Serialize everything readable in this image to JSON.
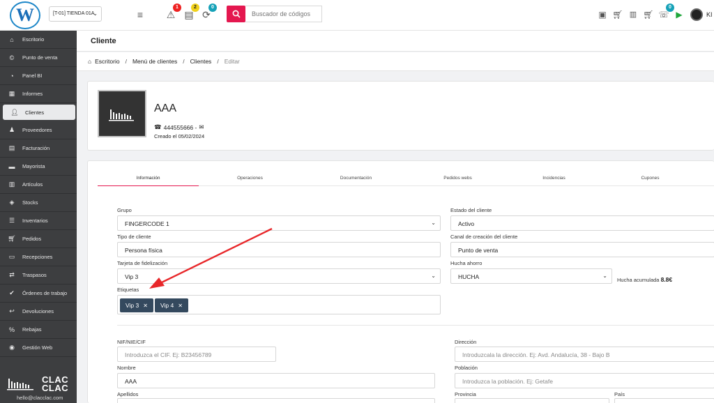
{
  "topbar": {
    "logo_letter": "W",
    "store_selector": "[T-01] TIENDA 01A",
    "badges": {
      "alerts": "1",
      "docs": "2",
      "refresh": "0",
      "messages": "0"
    },
    "search_placeholder": "Buscador de códigos",
    "user_initials": "KI"
  },
  "sidebar": {
    "items": [
      {
        "label": "Escritorio",
        "icon": "home-icon"
      },
      {
        "label": "Punto de venta",
        "icon": "cash-icon"
      },
      {
        "label": "Panel BI",
        "icon": "pie-chart-icon"
      },
      {
        "label": "Informes",
        "icon": "bar-chart-icon"
      },
      {
        "label": "Clientes",
        "icon": "users-icon"
      },
      {
        "label": "Proveedores",
        "icon": "supplier-icon"
      },
      {
        "label": "Facturación",
        "icon": "invoice-icon"
      },
      {
        "label": "Mayorista",
        "icon": "warehouse-icon"
      },
      {
        "label": "Artículos",
        "icon": "barcode-icon"
      },
      {
        "label": "Stocks",
        "icon": "tags-icon"
      },
      {
        "label": "Inventarios",
        "icon": "list-icon"
      },
      {
        "label": "Pedidos",
        "icon": "cart-icon"
      },
      {
        "label": "Recepciones",
        "icon": "inbox-icon"
      },
      {
        "label": "Traspasos",
        "icon": "transfer-icon"
      },
      {
        "label": "Órdenes de trabajo",
        "icon": "check-icon"
      },
      {
        "label": "Devoluciones",
        "icon": "return-cart-icon"
      },
      {
        "label": "Rebajas",
        "icon": "sale-icon"
      },
      {
        "label": "Gestión Web",
        "icon": "globe-icon"
      }
    ],
    "active_index": 4,
    "brand_line1": "CLAC",
    "brand_line2": "CLAC",
    "brand_email": "hello@clacclac.com"
  },
  "page": {
    "title": "Cliente",
    "breadcrumb": [
      "Escritorio",
      "Menú de clientes",
      "Clientes",
      "Editar"
    ]
  },
  "profile": {
    "name": "AAA",
    "phone": "444555666 -",
    "created": "Creado el 05/02/2024"
  },
  "tabs": [
    "Información",
    "Operaciones",
    "Documentación",
    "Pedidos webs",
    "Incidencias",
    "Cupones"
  ],
  "form": {
    "grupo_label": "Grupo",
    "grupo_value": "FINGERCODE 1",
    "estado_label": "Estado del cliente",
    "estado_value": "Activo",
    "tipo_label": "Tipo de cliente",
    "tipo_value": "Persona física",
    "canal_label": "Canal de creación del cliente",
    "canal_value": "Punto de venta",
    "tarjeta_label": "Tarjeta de fidelización",
    "tarjeta_value": "Vip 3",
    "hucha_label": "Hucha ahorro",
    "hucha_value": "HUCHA",
    "hucha_acc_label": "Hucha acumulada",
    "hucha_acc_value": "8.8€",
    "etiquetas_label": "Etiquetas",
    "tags": [
      "Vip 3",
      "Vip 4"
    ],
    "nif_label": "NIF/NIE/CIF",
    "nif_placeholder": "Introduzca el CIF. Ej: B23456789",
    "direccion_label": "Dirección",
    "direccion_placeholder": "Introduzcala la dirección. Ej: Avd. Andalucía, 38 - Bajo B",
    "nombre_label": "Nombre",
    "nombre_value": "AAA",
    "poblacion_label": "Población",
    "poblacion_placeholder": "Introduzca la población. Ej: Getafe",
    "apellidos_label": "Apellidos",
    "provincia_label": "Provincia",
    "pais_label": "País"
  },
  "colors": {
    "accent": "#e4174f",
    "sidebar": "#3d3e40",
    "tag": "#34495e",
    "arrow": "#e8272a"
  }
}
